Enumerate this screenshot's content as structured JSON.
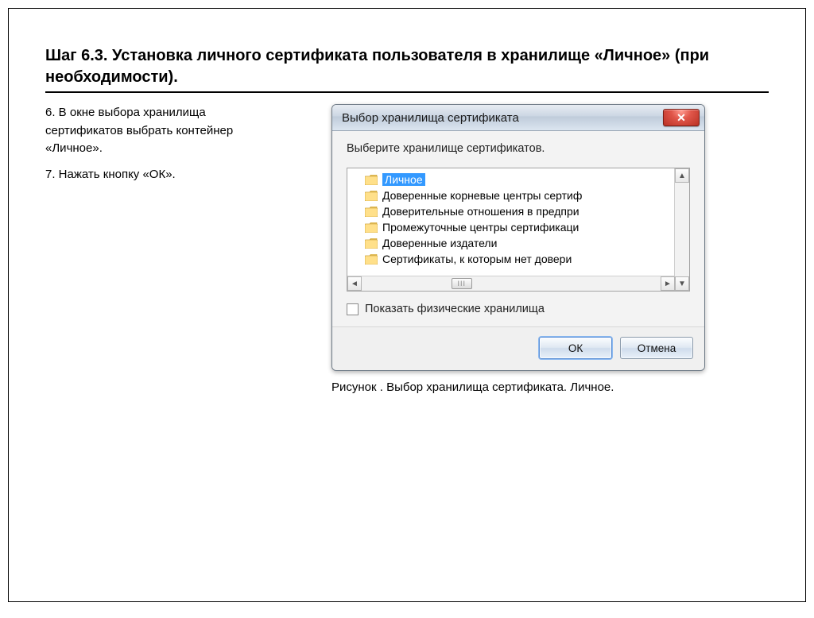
{
  "heading": "Шаг 6.3. Установка личного сертификата пользователя в хранилище «Личное» (при необходимости).",
  "steps": {
    "s6": "6. В окне выбора хранилища сертификатов выбрать контейнер «Личное».",
    "s7": "7. Нажать кнопку «ОК»."
  },
  "caption": "Рисунок . Выбор хранилища сертификата. Личное.",
  "dialog": {
    "title": "Выбор хранилища сертификата",
    "close_glyph": "✕",
    "prompt": "Выберите хранилище сертификатов.",
    "tree": {
      "items": [
        {
          "label": "Личное",
          "selected": true
        },
        {
          "label": "Доверенные корневые центры сертиф"
        },
        {
          "label": "Доверительные отношения в предпри"
        },
        {
          "label": "Промежуточные центры сертификаци"
        },
        {
          "label": "Доверенные издатели"
        },
        {
          "label": "Сертификаты, к которым нет довери"
        }
      ]
    },
    "checkbox": "Показать физические хранилища",
    "ok": "ОК",
    "cancel": "Отмена",
    "scroll_thumb": "III"
  }
}
